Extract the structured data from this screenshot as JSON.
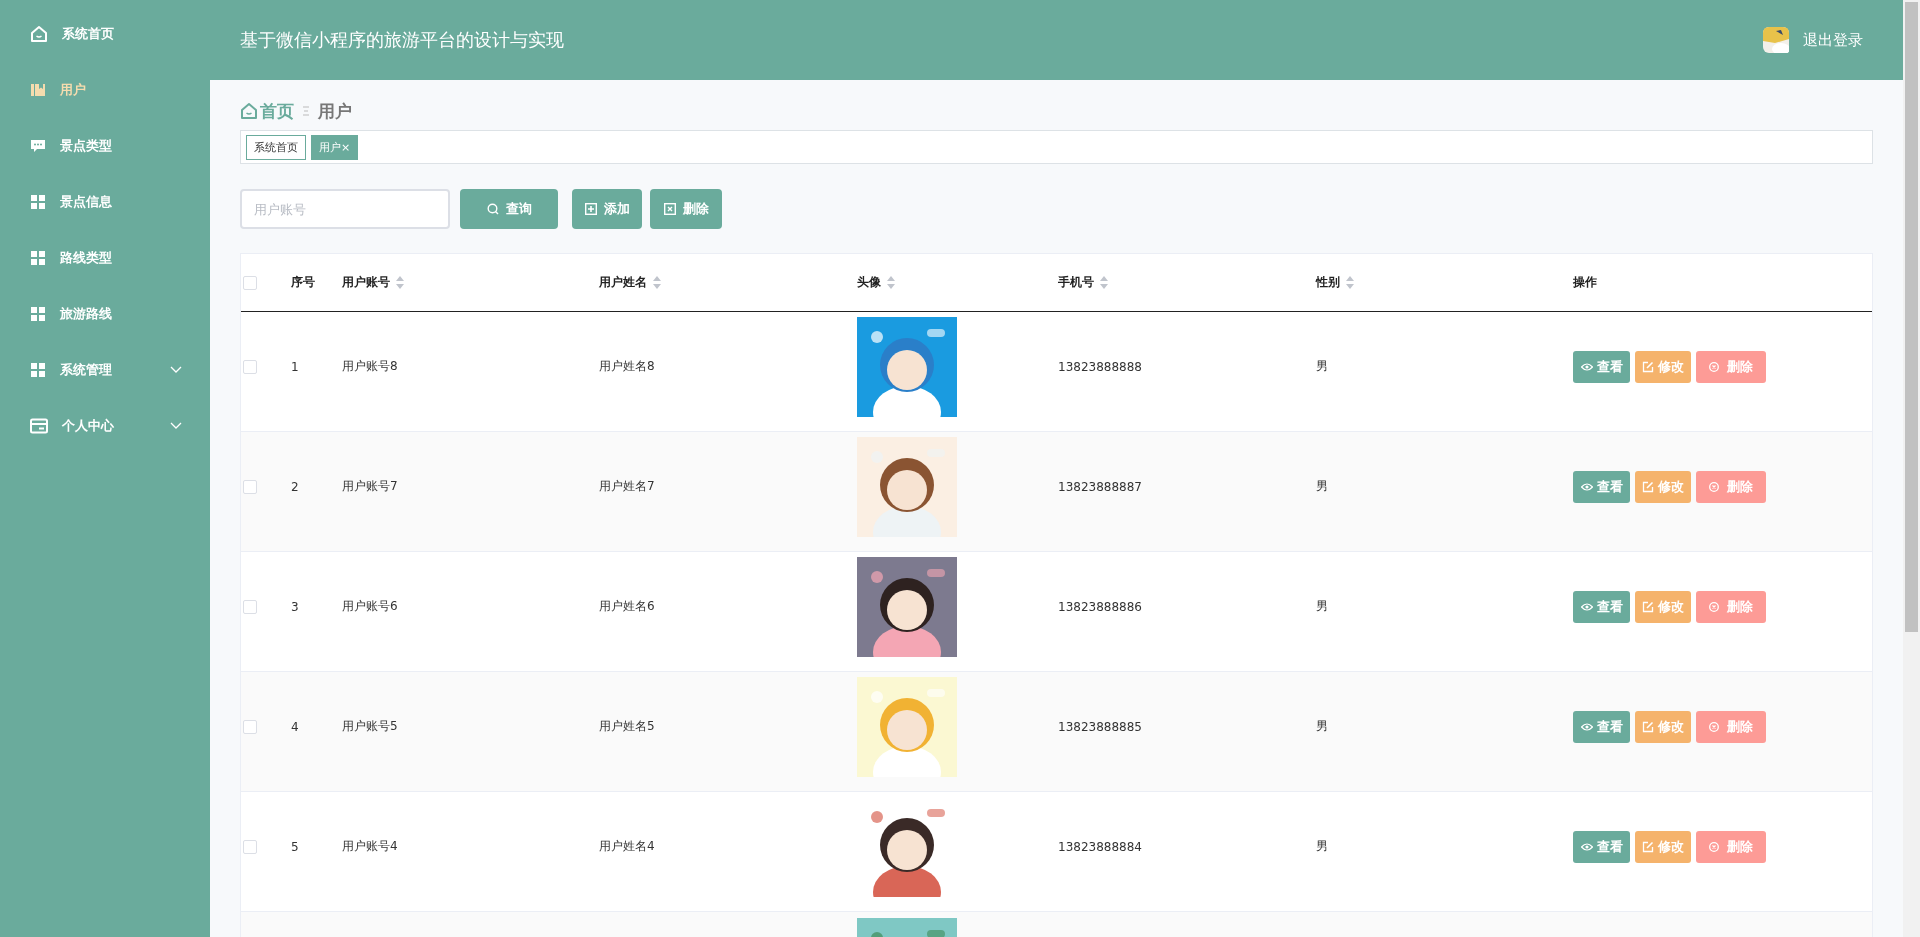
{
  "header": {
    "title": "基于微信小程序的旅游平台的设计与实现",
    "logout": "退出登录"
  },
  "sidebar": {
    "items": [
      {
        "label": "系统首页",
        "kind": "home",
        "selected": false,
        "expandable": false
      },
      {
        "label": "用户",
        "kind": "book",
        "selected": true,
        "expandable": false
      },
      {
        "label": "景点类型",
        "kind": "chat",
        "selected": false,
        "expandable": false
      },
      {
        "label": "景点信息",
        "kind": "grid",
        "selected": false,
        "expandable": false
      },
      {
        "label": "路线类型",
        "kind": "grid",
        "selected": false,
        "expandable": false
      },
      {
        "label": "旅游路线",
        "kind": "grid",
        "selected": false,
        "expandable": false
      },
      {
        "label": "系统管理",
        "kind": "grid",
        "selected": false,
        "expandable": true
      },
      {
        "label": "个人中心",
        "kind": "card",
        "selected": false,
        "expandable": true
      }
    ]
  },
  "breadcrumb": [
    {
      "label": "首页",
      "kind": "home"
    },
    {
      "label": "用户",
      "kind": "current"
    }
  ],
  "tabs": [
    {
      "label": "系统首页",
      "selected": false
    },
    {
      "label": "用户",
      "selected": true,
      "close": "×"
    }
  ],
  "search": {
    "placeholder": "用户账号"
  },
  "toolbar": [
    {
      "label": "查询",
      "kind": "search"
    },
    {
      "label": "添加",
      "kind": "add"
    },
    {
      "label": "删除",
      "kind": "delete"
    }
  ],
  "table": {
    "header_checkbox": {
      "checked": false
    },
    "columns": [
      {
        "label": "序号",
        "sortable": false
      },
      {
        "label": "用户账号",
        "sortable": true
      },
      {
        "label": "用户姓名",
        "sortable": true
      },
      {
        "label": "头像",
        "sortable": true
      },
      {
        "label": "手机号",
        "sortable": true
      },
      {
        "label": "性别",
        "sortable": true
      },
      {
        "label": "操作",
        "sortable": false
      }
    ],
    "rows": [
      {
        "checked": false,
        "index": "1",
        "account": "用户账号8",
        "name": "用户姓名8",
        "phone": "13823888888",
        "gender": "男",
        "actions": [
          {
            "label": "查看",
            "kind": "view"
          },
          {
            "label": "修改",
            "kind": "edit"
          },
          {
            "label": "删除",
            "kind": "delete"
          }
        ]
      },
      {
        "checked": false,
        "index": "2",
        "account": "用户账号7",
        "name": "用户姓名7",
        "phone": "13823888887",
        "gender": "男",
        "actions": [
          {
            "label": "查看",
            "kind": "view"
          },
          {
            "label": "修改",
            "kind": "edit"
          },
          {
            "label": "删除",
            "kind": "delete"
          }
        ]
      },
      {
        "checked": false,
        "index": "3",
        "account": "用户账号6",
        "name": "用户姓名6",
        "phone": "13823888886",
        "gender": "男",
        "actions": [
          {
            "label": "查看",
            "kind": "view"
          },
          {
            "label": "修改",
            "kind": "edit"
          },
          {
            "label": "删除",
            "kind": "delete"
          }
        ]
      },
      {
        "checked": false,
        "index": "4",
        "account": "用户账号5",
        "name": "用户姓名5",
        "phone": "13823888885",
        "gender": "男",
        "actions": [
          {
            "label": "查看",
            "kind": "view"
          },
          {
            "label": "修改",
            "kind": "edit"
          },
          {
            "label": "删除",
            "kind": "delete"
          }
        ]
      },
      {
        "checked": false,
        "index": "5",
        "account": "用户账号4",
        "name": "用户姓名4",
        "phone": "13823888884",
        "gender": "男",
        "actions": [
          {
            "label": "查看",
            "kind": "view"
          },
          {
            "label": "修改",
            "kind": "edit"
          },
          {
            "label": "删除",
            "kind": "delete"
          }
        ]
      }
    ]
  }
}
